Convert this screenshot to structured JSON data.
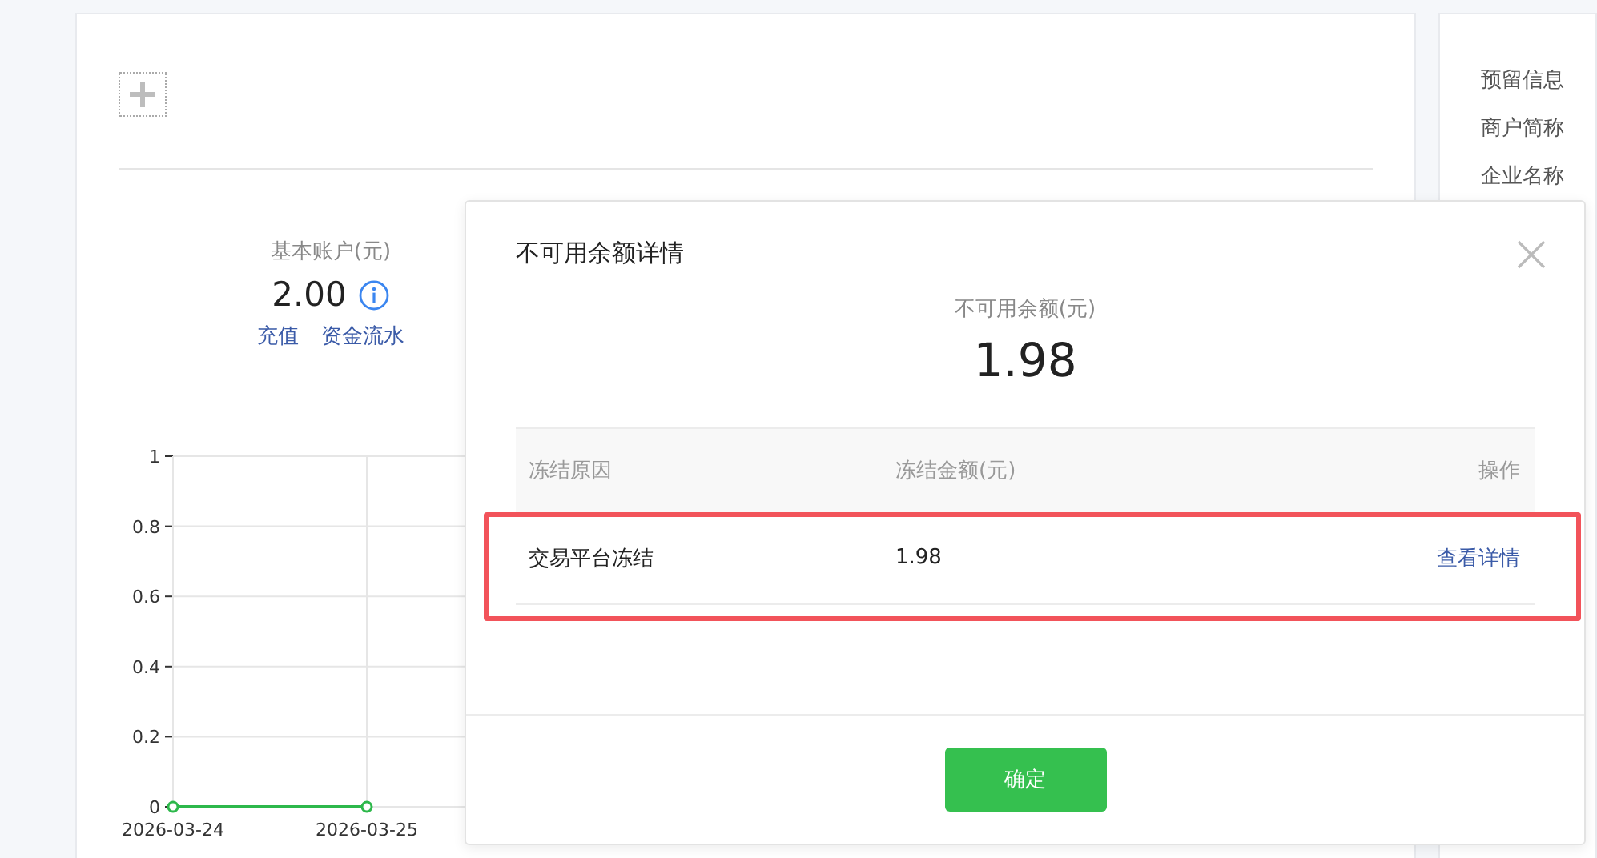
{
  "account": {
    "label": "基本账户(元)",
    "amount": "2.00",
    "links": [
      "充值",
      "资金流水"
    ]
  },
  "chart_data": {
    "type": "line",
    "categories": [
      "2026-03-24",
      "2026-03-25"
    ],
    "series": [
      {
        "color": "#2db84b",
        "values": [
          0,
          0
        ],
        "marker": true
      }
    ],
    "grid": true,
    "ylim": [
      0,
      1
    ],
    "yticks": [
      0,
      0.2,
      0.4,
      0.6,
      0.8,
      1
    ]
  },
  "side_panel": {
    "labels": [
      "预留信息",
      "商户简称",
      "企业名称"
    ]
  },
  "dialog": {
    "title": "不可用余额详情",
    "summary_label": "不可用余额(元)",
    "summary_value": "1.98",
    "columns": [
      "冻结原因",
      "冻结金额(元)",
      "操作"
    ],
    "rows": [
      {
        "reason": "交易平台冻结",
        "amount": "1.98",
        "action": "查看详情",
        "highlighted": true
      }
    ],
    "confirm": "确定"
  }
}
